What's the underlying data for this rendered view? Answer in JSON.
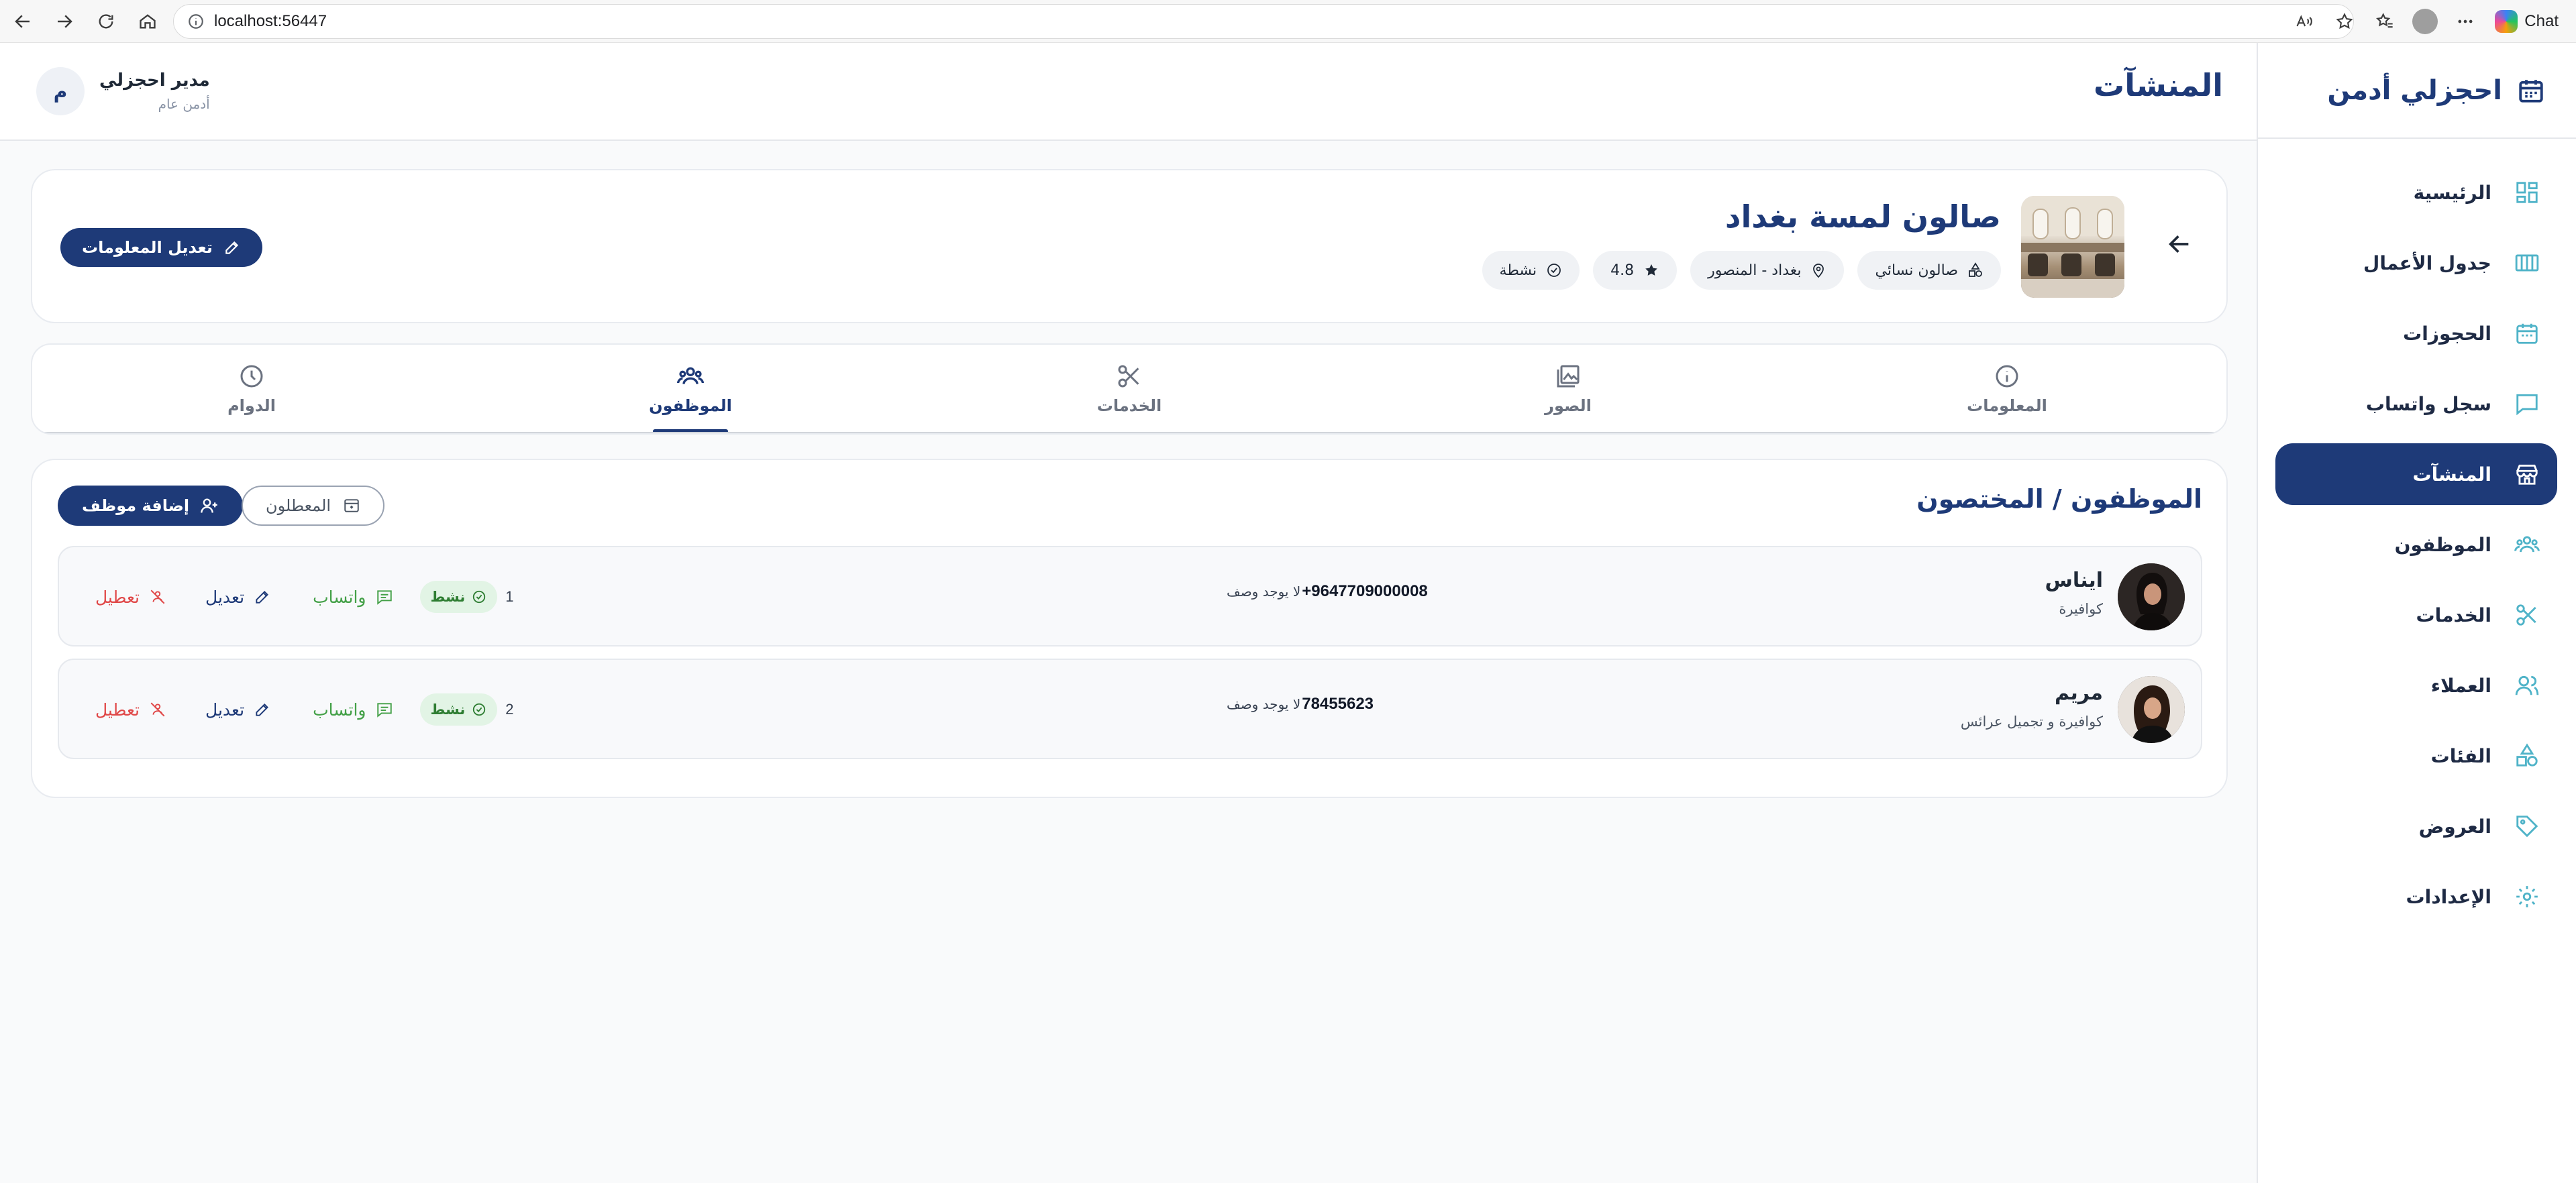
{
  "browser": {
    "url": "localhost:56447",
    "chat_label": "Chat"
  },
  "sidebar": {
    "brand": "احجزلي أدمن",
    "items": [
      {
        "label": "الرئيسية",
        "icon": "dashboard-icon",
        "active": false
      },
      {
        "label": "جدول الأعمال",
        "icon": "schedule-icon",
        "active": false
      },
      {
        "label": "الحجوزات",
        "icon": "calendar-icon",
        "active": false
      },
      {
        "label": "سجل واتساب",
        "icon": "chat-icon",
        "active": false
      },
      {
        "label": "المنشآت",
        "icon": "store-icon",
        "active": true
      },
      {
        "label": "الموظفون",
        "icon": "staff-icon",
        "active": false
      },
      {
        "label": "الخدمات",
        "icon": "scissors-icon",
        "active": false
      },
      {
        "label": "العملاء",
        "icon": "customers-icon",
        "active": false
      },
      {
        "label": "الفئات",
        "icon": "categories-icon",
        "active": false
      },
      {
        "label": "العروض",
        "icon": "tag-icon",
        "active": false
      },
      {
        "label": "الإعدادات",
        "icon": "settings-icon",
        "active": false
      }
    ]
  },
  "header": {
    "title": "المنشآت",
    "user": {
      "initial": "م",
      "name": "مدير احجزلي",
      "role": "أدمن عام"
    }
  },
  "facility": {
    "name": "صالون لمسة بغداد",
    "type": "صالون نسائي",
    "location": "بغداد - المنصور",
    "rating": "4.8",
    "status": "نشطة",
    "edit_label": "تعديل المعلومات"
  },
  "tabs": [
    {
      "label": "المعلومات",
      "icon": "info-icon",
      "active": false
    },
    {
      "label": "الصور",
      "icon": "images-icon",
      "active": false
    },
    {
      "label": "الخدمات",
      "icon": "scissors-icon",
      "active": false
    },
    {
      "label": "الموظفون",
      "icon": "staff-icon",
      "active": true
    },
    {
      "label": "الدوام",
      "icon": "clock-icon",
      "active": false
    }
  ],
  "staff_section": {
    "title": "الموظفون / المختصون",
    "add_label": "إضافة موظف",
    "disabled_label": "المعطلون",
    "rows": [
      {
        "name": "ايناس",
        "role": "كوافيرة",
        "phone": "+9647709000008",
        "description": "لا يوجد وصف",
        "index": "1",
        "status": "نشط",
        "whatsapp": "واتساب",
        "edit": "تعديل",
        "disable": "تعطيل"
      },
      {
        "name": "مريم",
        "role": "كوافيرة و تجميل عرائس",
        "phone": "78455623",
        "description": "لا يوجد وصف",
        "index": "2",
        "status": "نشط",
        "whatsapp": "واتساب",
        "edit": "تعديل",
        "disable": "تعطيل"
      }
    ]
  },
  "colors": {
    "primary": "#1e3a78",
    "accent": "#4fb3c8",
    "success": "#43a047",
    "danger": "#e04848"
  }
}
